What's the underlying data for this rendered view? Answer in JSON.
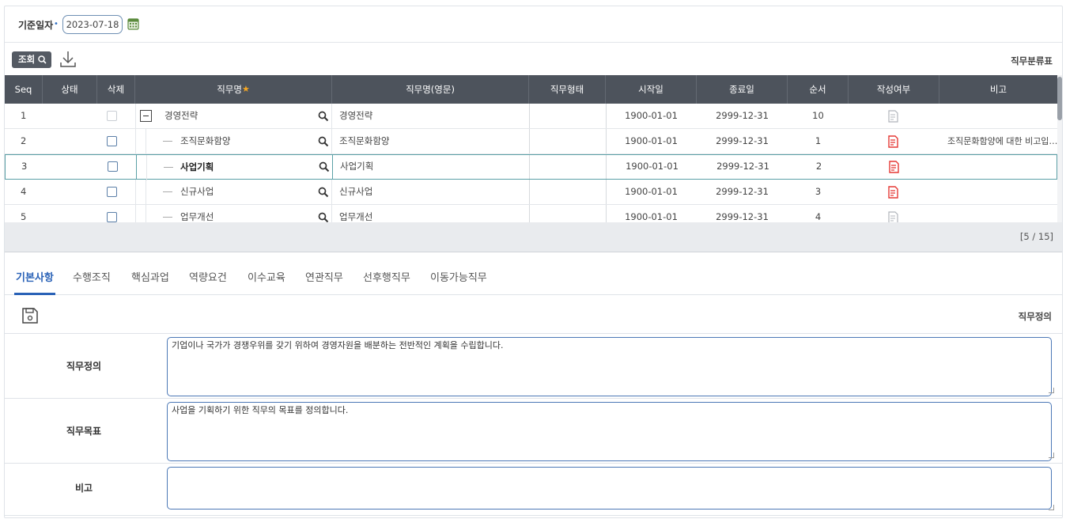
{
  "filter": {
    "label": "기준일자",
    "required_mark": "•",
    "date_value": "2023-07-18"
  },
  "toolbar": {
    "search_label": "조회",
    "title": "직무분류표"
  },
  "grid": {
    "columns": [
      "Seq",
      "상태",
      "삭제",
      "직무명",
      "직무명(영문)",
      "직무형태",
      "시작일",
      "종료일",
      "순서",
      "작성여부",
      "비고"
    ],
    "required_star": "★",
    "rows": [
      {
        "seq": "1",
        "name": "경영전략",
        "name_en": "경영전략",
        "start": "1900-01-01",
        "end": "2999-12-31",
        "order": "10",
        "note": ""
      },
      {
        "seq": "2",
        "name": "조직문화함양",
        "name_en": "조직문화함양",
        "start": "1900-01-01",
        "end": "2999-12-31",
        "order": "1",
        "note": "조직문화함양에 대한 비고입…"
      },
      {
        "seq": "3",
        "name": "사업기획",
        "name_en": "사업기획",
        "start": "1900-01-01",
        "end": "2999-12-31",
        "order": "2",
        "note": ""
      },
      {
        "seq": "4",
        "name": "신규사업",
        "name_en": "신규사업",
        "start": "1900-01-01",
        "end": "2999-12-31",
        "order": "3",
        "note": ""
      },
      {
        "seq": "5",
        "name": "업무개선",
        "name_en": "업무개선",
        "start": "1900-01-01",
        "end": "2999-12-31",
        "order": "4",
        "note": ""
      }
    ],
    "pager": "[5 / 15]",
    "colors": {
      "header_bg": "#4d535c",
      "doc_filled": "#e53935",
      "doc_empty": "#b0b5bb",
      "selected_border": "#5aa0a6"
    }
  },
  "tabs": [
    "기본사항",
    "수행조직",
    "핵심과업",
    "역량요건",
    "이수교육",
    "연관직무",
    "선후행직무",
    "이동가능직무"
  ],
  "form": {
    "title": "직무정의",
    "fields": [
      {
        "label": "직무정의",
        "value": "기업이나 국가가 경쟁우위를 갖기 위하여 경영자원을 배분하는 전반적인 계획을 수립합니다."
      },
      {
        "label": "직무목표",
        "value": "사업을 기획하기 위한 직무의 목표를 정의합니다."
      },
      {
        "label": "비고",
        "value": ""
      }
    ]
  }
}
